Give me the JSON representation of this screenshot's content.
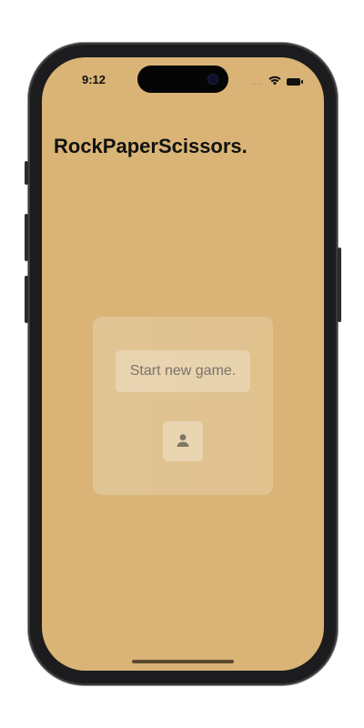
{
  "status_bar": {
    "time": "9:12",
    "signal_dots": "....",
    "icons": [
      "wifi-icon",
      "battery-icon"
    ]
  },
  "app": {
    "title": "RockPaperScissors."
  },
  "card": {
    "start_button_label": "Start new game.",
    "player_button_icon": "person-icon"
  },
  "colors": {
    "background": "#d9b476",
    "title": "#111111",
    "button_text": "#7a7369",
    "icon": "#7f7563"
  }
}
